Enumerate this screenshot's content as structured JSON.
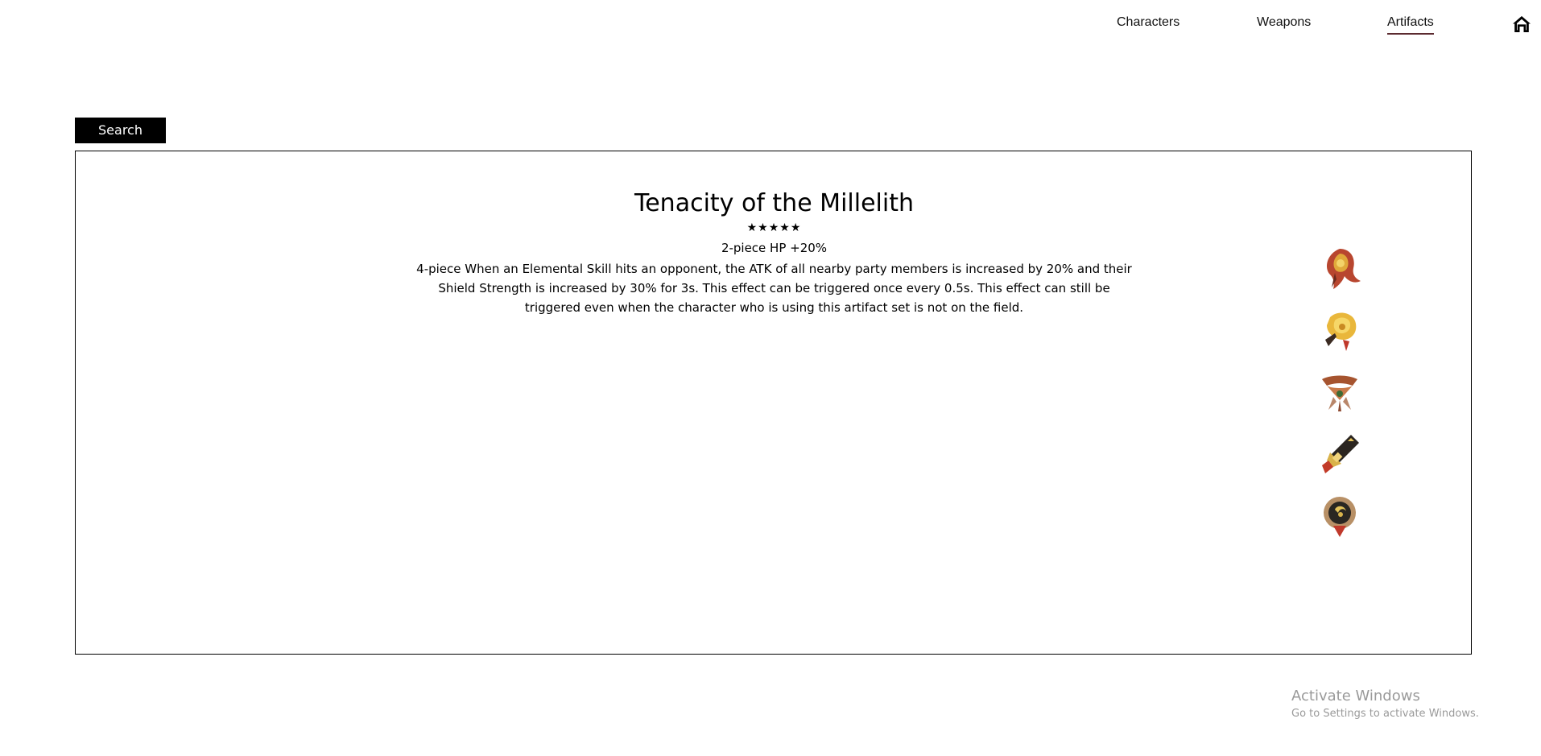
{
  "nav": {
    "items": [
      {
        "label": "Characters",
        "active": false
      },
      {
        "label": "Weapons",
        "active": false
      },
      {
        "label": "Artifacts",
        "active": true
      }
    ],
    "home_icon": "home-icon",
    "active_underline_color": "#5b2b30"
  },
  "search": {
    "button_label": "Search"
  },
  "artifact_set": {
    "name": "Tenacity of the Millelith",
    "rarity_stars": "★★★★★",
    "rarity": 5,
    "two_piece": "2-piece HP +20%",
    "four_piece": "4-piece When an Elemental Skill hits an opponent, the ATK of all nearby party members is increased by 20% and their Shield Strength is increased by 30% for 3s. This effect can be triggered once every 0.5s. This effect can still be triggered even when the character who is using this artifact set is not on the field.",
    "pieces": [
      {
        "icon": "flower-of-life-icon"
      },
      {
        "icon": "plume-of-death-icon"
      },
      {
        "icon": "sands-of-eon-icon"
      },
      {
        "icon": "goblet-of-eonothem-icon"
      },
      {
        "icon": "circlet-of-logos-icon"
      }
    ]
  },
  "watermark": {
    "title": "Activate Windows",
    "subtitle": "Go to Settings to activate Windows."
  }
}
